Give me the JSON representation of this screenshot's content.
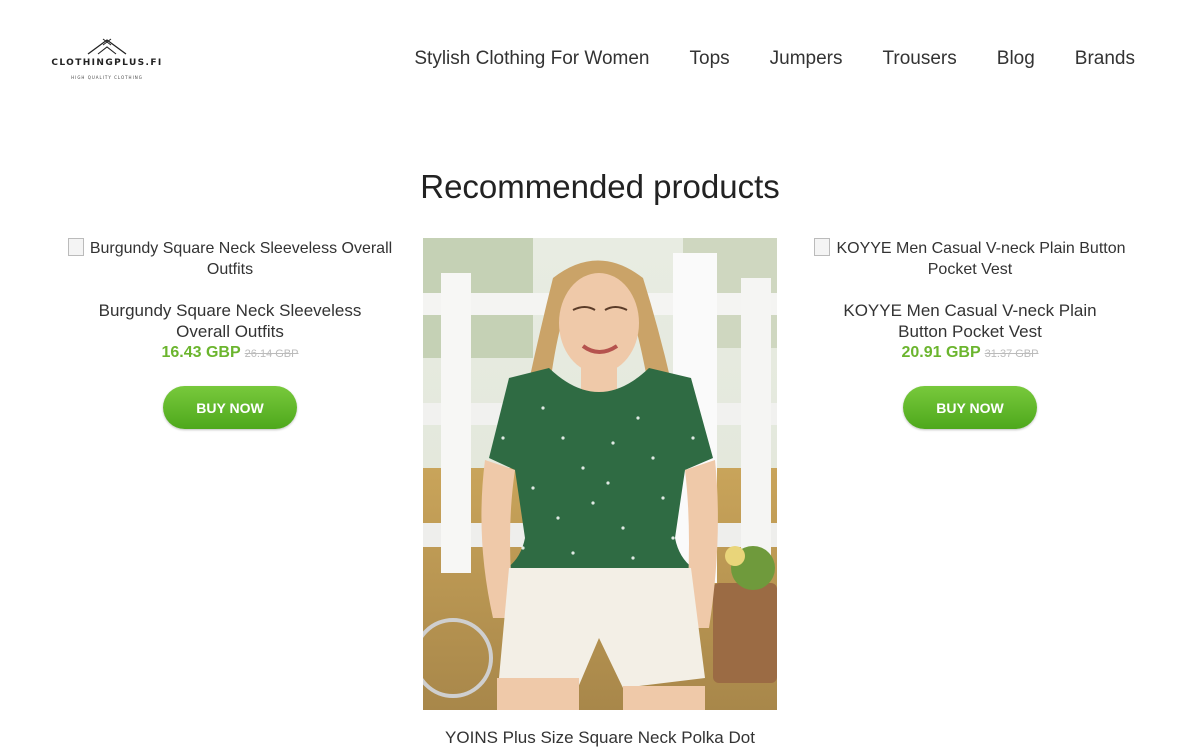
{
  "header": {
    "logo_text": "CLOTHINGPLUS.FI",
    "logo_tagline": "HIGH QUALITY CLOTHING",
    "nav": [
      {
        "label": "Stylish Clothing For Women"
      },
      {
        "label": "Tops"
      },
      {
        "label": "Jumpers"
      },
      {
        "label": "Trousers"
      },
      {
        "label": "Blog"
      },
      {
        "label": "Brands"
      }
    ]
  },
  "main": {
    "title": "Recommended products",
    "products": [
      {
        "image_alt": "Burgundy Square Neck Sleeveless Overall Outfits",
        "name": "Burgundy Square Neck Sleeveless Overall Outfits",
        "price": "16.43 GBP",
        "old_price": "26.14 GBP",
        "button": "BUY NOW"
      },
      {
        "name": "YOINS Plus Size Square Neck Polka Dot"
      },
      {
        "image_alt": "KOYYE Men Casual V-neck Plain Button Pocket Vest",
        "name": "KOYYE Men Casual V-neck Plain Button Pocket Vest",
        "price": "20.91 GBP",
        "old_price": "31.37 GBP",
        "button": "BUY NOW"
      }
    ]
  },
  "colors": {
    "price_green": "#6bb52e",
    "button_green": "#5db427",
    "top_green": "#2f6b43"
  }
}
